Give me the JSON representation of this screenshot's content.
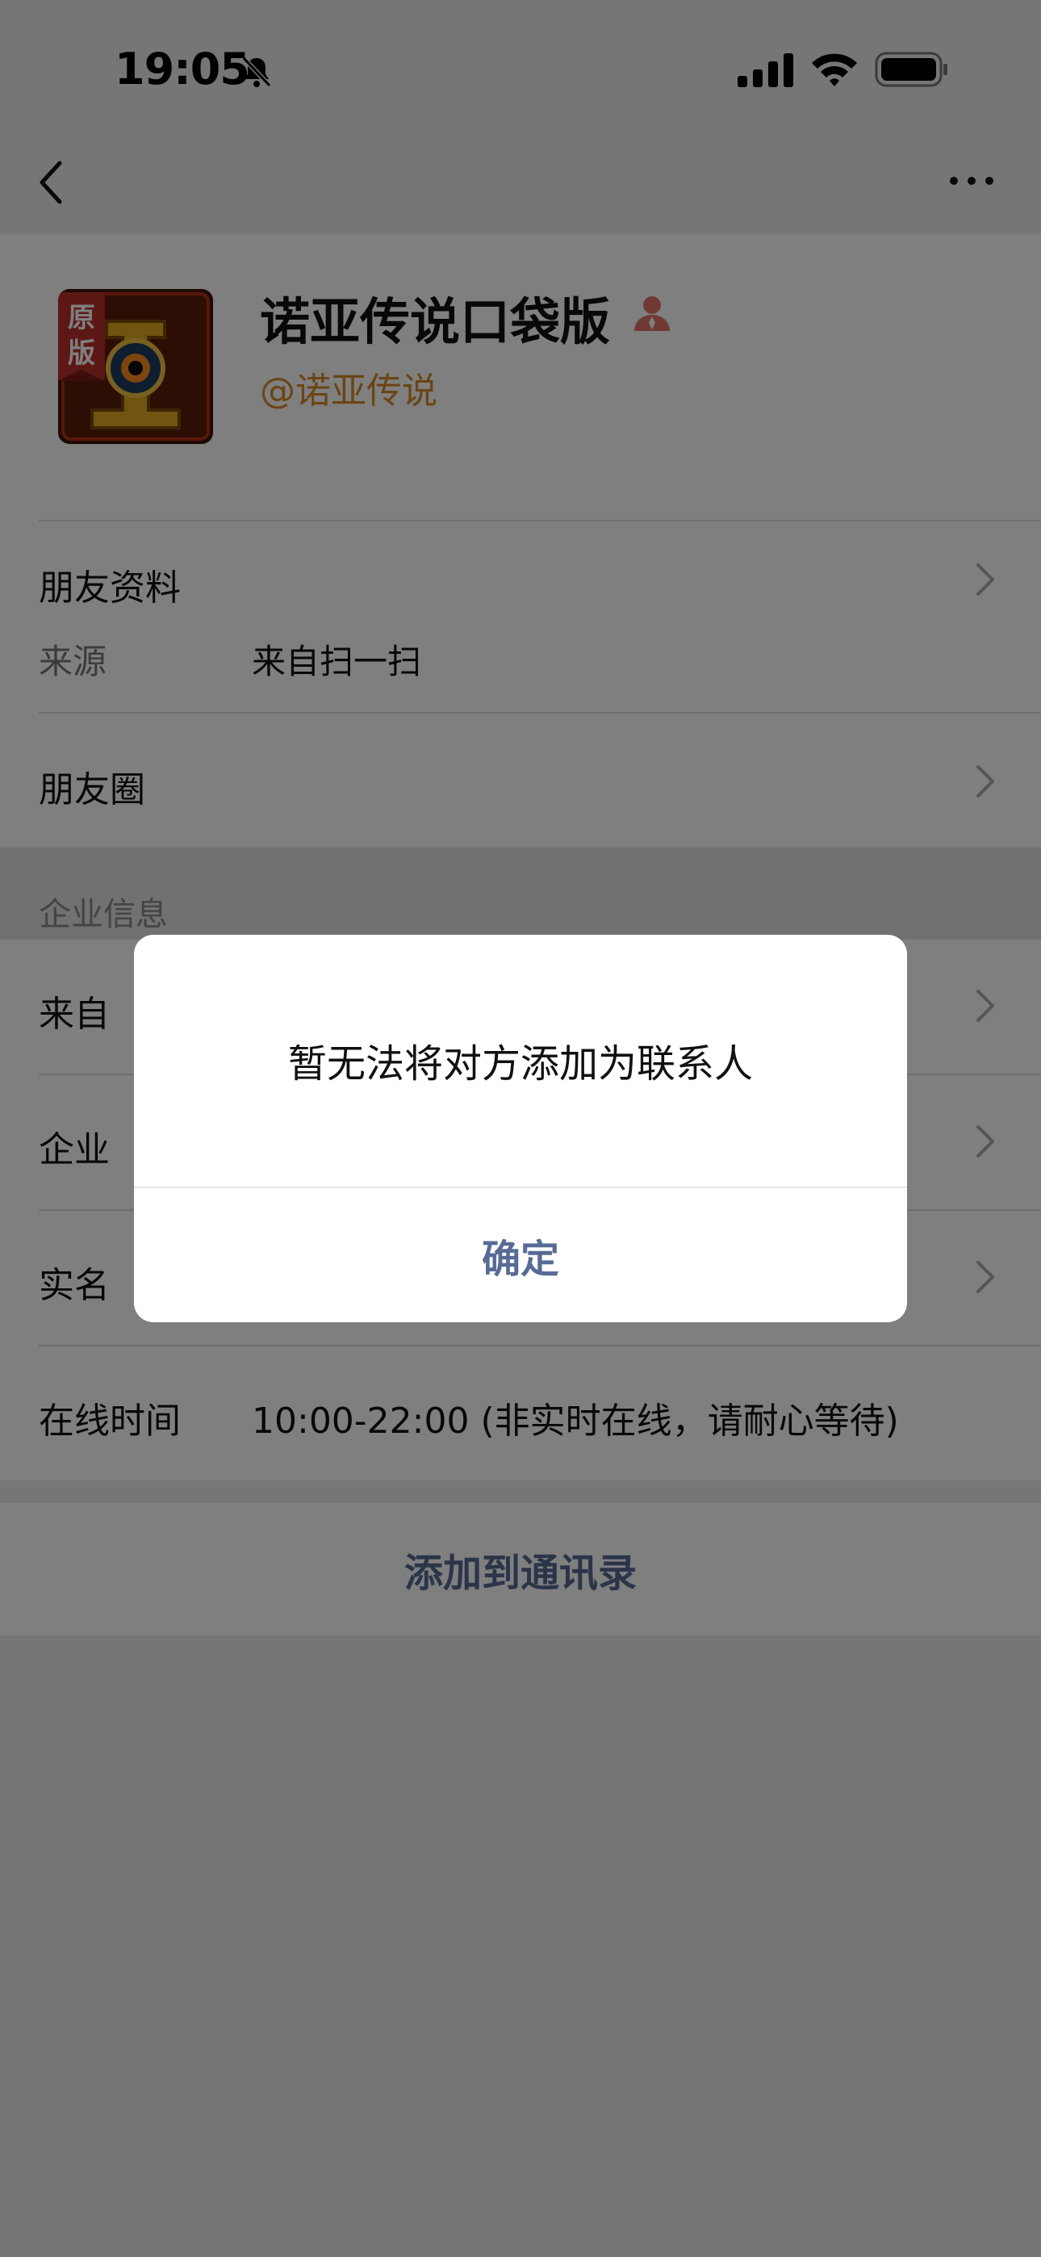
{
  "status_bar": {
    "time": "19:05"
  },
  "profile": {
    "name": "诺亚传说口袋版",
    "handle": "@诺亚传说",
    "avatar_badge": "原版"
  },
  "friend_info": {
    "title": "朋友资料",
    "source_label": "来源",
    "source_value": "来自扫一扫"
  },
  "moments": {
    "title": "朋友圈"
  },
  "enterprise": {
    "section_label": "企业信息",
    "from_label": "来自",
    "company_label": "企业",
    "realname_label": "实名",
    "online_label": "在线时间",
    "online_value": "10:00-22:00 (非实时在线，请耐心等待)"
  },
  "actions": {
    "add_to_contacts": "添加到通讯录"
  },
  "dialog": {
    "message": "暂无法将对方添加为联系人",
    "confirm": "确定"
  },
  "colors": {
    "link": "#576b95",
    "handle": "#d68a2a",
    "person_icon": "#e0736a"
  }
}
